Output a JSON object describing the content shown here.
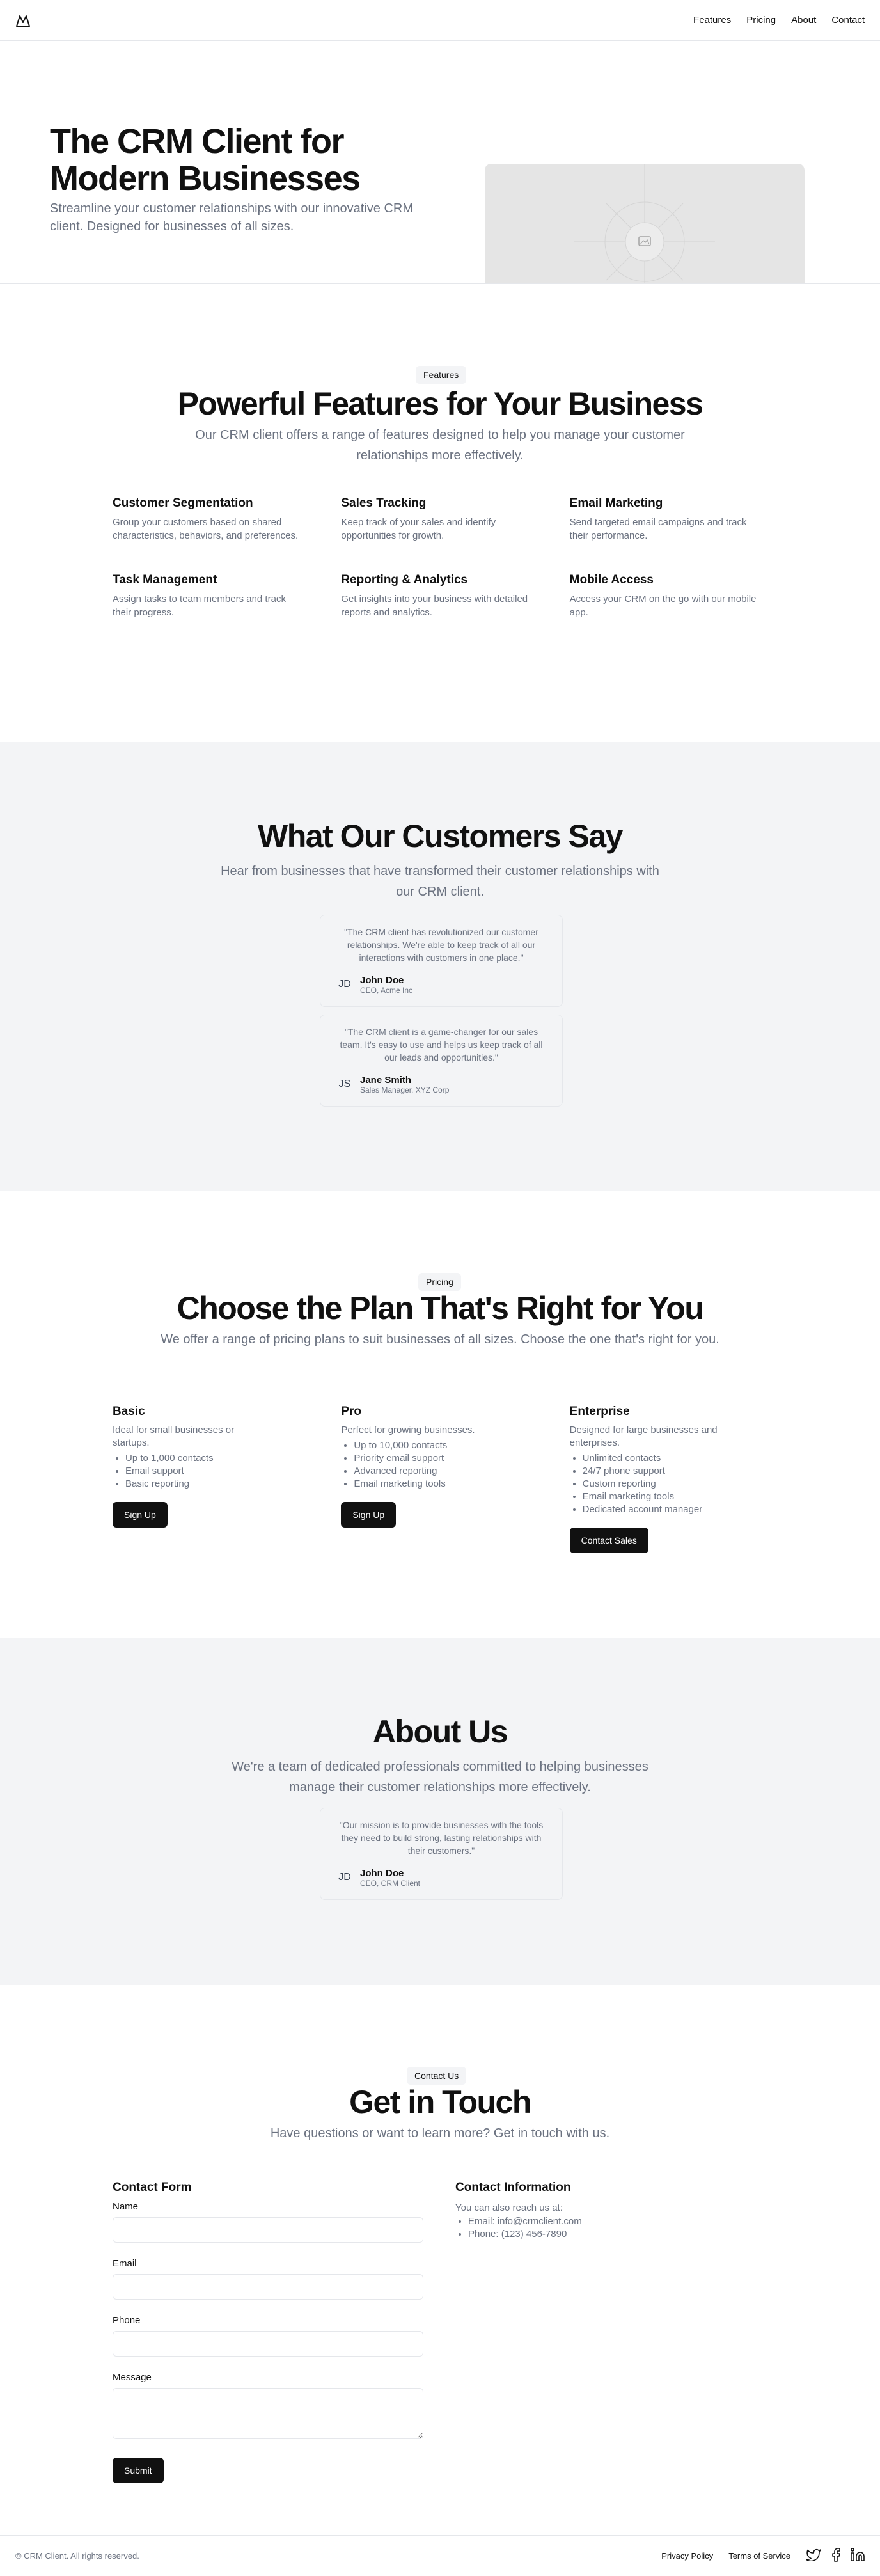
{
  "header": {
    "nav": [
      "Features",
      "Pricing",
      "About",
      "Contact"
    ]
  },
  "hero": {
    "title_line1": "The CRM Client for",
    "title_line2": "Modern Businesses",
    "subtitle": "Streamline your customer relationships with our innovative CRM client. Designed for businesses of all sizes."
  },
  "features": {
    "pill": "Features",
    "title": "Powerful Features for Your Business",
    "subtitle": "Our CRM client offers a range of features designed to help you manage your customer relationships more effectively.",
    "items": [
      {
        "title": "Customer Segmentation",
        "desc": "Group your customers based on shared characteristics, behaviors, and preferences."
      },
      {
        "title": "Sales Tracking",
        "desc": "Keep track of your sales and identify opportunities for growth."
      },
      {
        "title": "Email Marketing",
        "desc": "Send targeted email campaigns and track their performance."
      },
      {
        "title": "Task Management",
        "desc": "Assign tasks to team members and track their progress."
      },
      {
        "title": "Reporting & Analytics",
        "desc": "Get insights into your business with detailed reports and analytics."
      },
      {
        "title": "Mobile Access",
        "desc": "Access your CRM on the go with our mobile app."
      }
    ]
  },
  "testimonials": {
    "title": "What Our Customers Say",
    "subtitle": "Hear from businesses that have transformed their customer relationships with our CRM client.",
    "items": [
      {
        "quote": "\"The CRM client has revolutionized our customer relationships. We're able to keep track of all our interactions with customers in one place.\"",
        "initials": "JD",
        "name": "John Doe",
        "role": "CEO, Acme Inc"
      },
      {
        "quote": "\"The CRM client is a game-changer for our sales team. It's easy to use and helps us keep track of all our leads and opportunities.\"",
        "initials": "JS",
        "name": "Jane Smith",
        "role": "Sales Manager, XYZ Corp"
      }
    ]
  },
  "pricing": {
    "pill": "Pricing",
    "title": "Choose the Plan That's Right for You",
    "subtitle": "We offer a range of pricing plans to suit businesses of all sizes. Choose the one that's right for you.",
    "plans": [
      {
        "name": "Basic",
        "desc": "Ideal for small businesses or startups.",
        "features": [
          "Up to 1,000 contacts",
          "Email support",
          "Basic reporting"
        ],
        "cta": "Sign Up"
      },
      {
        "name": "Pro",
        "desc": "Perfect for growing businesses.",
        "features": [
          "Up to 10,000 contacts",
          "Priority email support",
          "Advanced reporting",
          "Email marketing tools"
        ],
        "cta": "Sign Up"
      },
      {
        "name": "Enterprise",
        "desc": "Designed for large businesses and enterprises.",
        "features": [
          "Unlimited contacts",
          "24/7 phone support",
          "Custom reporting",
          "Email marketing tools",
          "Dedicated account manager"
        ],
        "cta": "Contact Sales"
      }
    ]
  },
  "about": {
    "title": "About Us",
    "subtitle": "We're a team of dedicated professionals committed to helping businesses manage their customer relationships more effectively.",
    "quote": "\"Our mission is to provide businesses with the tools they need to build strong, lasting relationships with their customers.\"",
    "initials": "JD",
    "name": "John Doe",
    "role": "CEO, CRM Client"
  },
  "contact": {
    "pill": "Contact Us",
    "title": "Get in Touch",
    "subtitle": "Have questions or want to learn more? Get in touch with us.",
    "form_title": "Contact Form",
    "labels": {
      "name": "Name",
      "email": "Email",
      "phone": "Phone",
      "message": "Message"
    },
    "submit": "Submit",
    "info_title": "Contact Information",
    "info_text": "You can also reach us at:",
    "info_items": [
      "Email: info@crmclient.com",
      "Phone: (123) 456-7890"
    ]
  },
  "footer": {
    "copyright": "© CRM Client. All rights reserved.",
    "links": [
      "Privacy Policy",
      "Terms of Service"
    ],
    "social_icons": [
      "twitter-icon",
      "facebook-icon",
      "linkedin-icon"
    ]
  }
}
